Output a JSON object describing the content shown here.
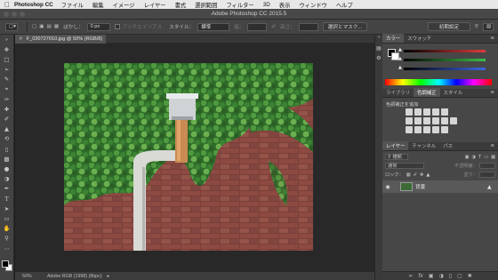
{
  "menubar": {
    "app_name": "Photoshop CC",
    "items": [
      "ファイル",
      "編集",
      "イメージ",
      "レイヤー",
      "書式",
      "選択範囲",
      "フィルター",
      "3D",
      "表示",
      "ウィンドウ",
      "ヘルプ"
    ]
  },
  "window": {
    "title": "Adobe Photoshop CC 2015.5"
  },
  "options": {
    "feather_label": "ぼかし：",
    "feather_value": "0 px",
    "antialias_label": "アンチエイリアス",
    "style_label": "スタイル：",
    "style_value": "標準",
    "width_label": "幅：",
    "height_label": "高さ：",
    "select_mask_label": "選択とマスク...",
    "workspace_label": "初期設定"
  },
  "document": {
    "tab_title": "F_020727010.jpg @ 50% (RGB/8)",
    "zoom": "50%",
    "profile": "Adobe RGB (1998) (8bpc)"
  },
  "panels": {
    "color_tabs": [
      "カラー",
      "スウォッチ"
    ],
    "adjust_tabs": [
      "ライブラリ",
      "色調補正",
      "スタイル"
    ],
    "adjust_add_label": "色調補正を追加",
    "layers_tabs": [
      "レイヤー",
      "チャンネル",
      "パス"
    ],
    "kind_label": "種類",
    "mode_label": "通常",
    "opacity_label": "不透明度：",
    "lock_label": "ロック：",
    "fill_label": "塗り：",
    "layer_name": "背景"
  },
  "colors": {
    "accent_red": "#e03c3c",
    "accent_green": "#3cbf4a",
    "accent_blue": "#3c64e0"
  }
}
